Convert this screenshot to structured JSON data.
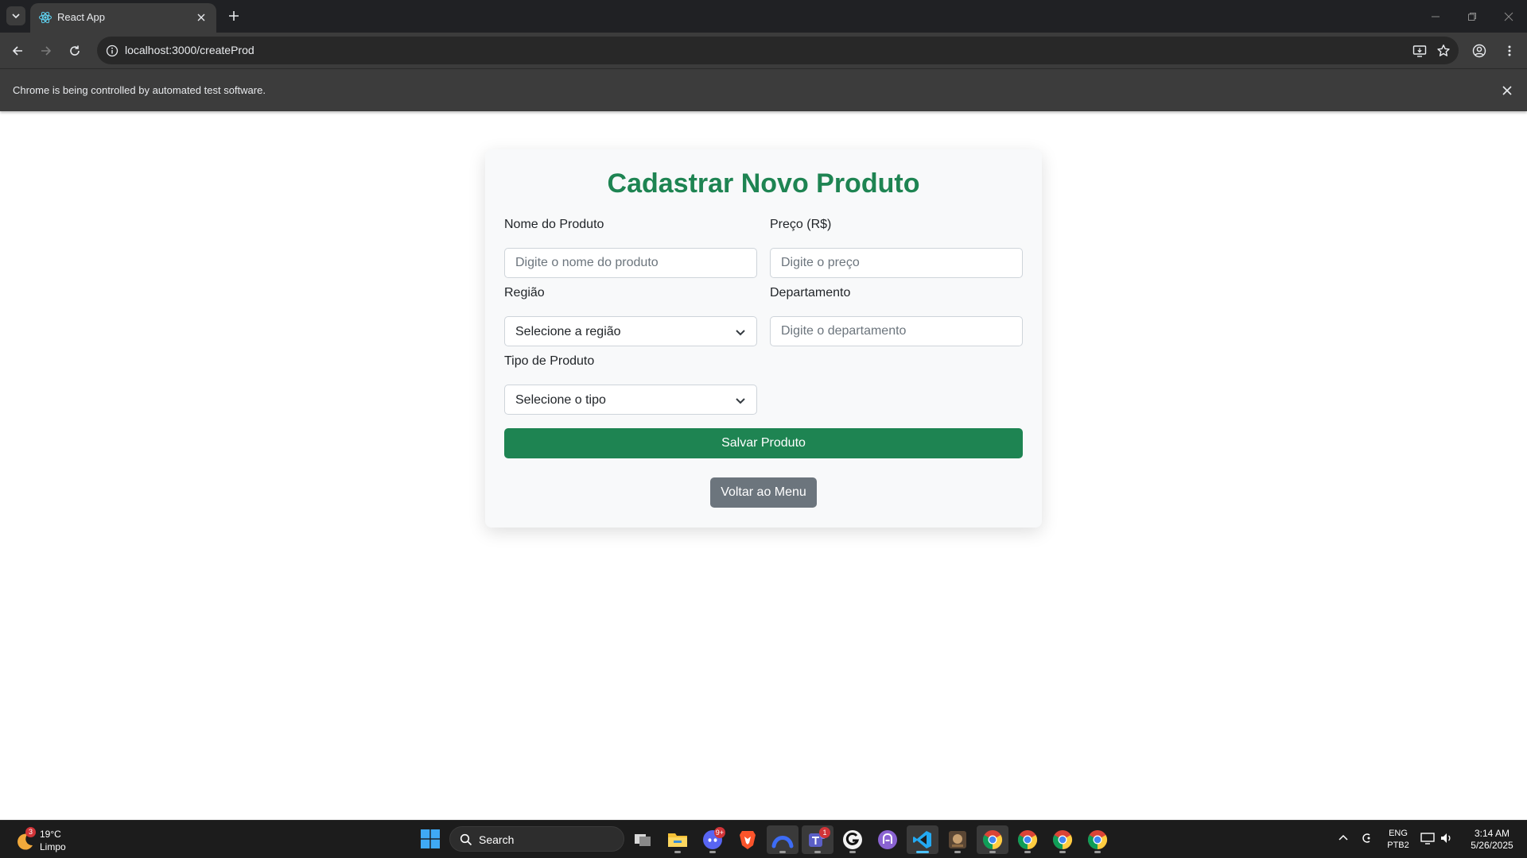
{
  "browser": {
    "tab": {
      "title": "React App"
    },
    "address_bar": {
      "url": "localhost:3000/createProd"
    },
    "infobar": {
      "message": "Chrome is being controlled by automated test software."
    }
  },
  "form": {
    "title": "Cadastrar Novo Produto",
    "fields": {
      "nome": {
        "label": "Nome do Produto",
        "placeholder": "Digite o nome do produto",
        "value": ""
      },
      "preco": {
        "label": "Preço (R$)",
        "placeholder": "Digite o preço",
        "value": ""
      },
      "regiao": {
        "label": "Região",
        "selected": "Selecione a região"
      },
      "departamento": {
        "label": "Departamento",
        "placeholder": "Digite o departamento",
        "value": ""
      },
      "tipo": {
        "label": "Tipo de Produto",
        "selected": "Selecione o tipo"
      }
    },
    "save_label": "Salvar Produto",
    "back_label": "Voltar ao Menu"
  },
  "colors": {
    "primary_green": "#1e8452",
    "secondary_gray": "#6c757d",
    "card_bg": "#f8f9fa"
  },
  "taskbar": {
    "weather": {
      "temp": "19°C",
      "condition": "Limpo",
      "badge": "3"
    },
    "search_label": "Search",
    "apps": [
      {
        "name": "task-view",
        "icon": "task-view-icon"
      },
      {
        "name": "file-explorer",
        "icon": "folder-icon"
      },
      {
        "name": "discord",
        "icon": "discord-icon",
        "badge": "9+"
      },
      {
        "name": "brave",
        "icon": "brave-icon"
      },
      {
        "name": "arc",
        "icon": "arc-icon"
      },
      {
        "name": "teams",
        "icon": "teams-icon",
        "badge": "1"
      },
      {
        "name": "app-g",
        "icon": "g-app-icon"
      },
      {
        "name": "github-desktop",
        "icon": "github-icon"
      },
      {
        "name": "vscode",
        "icon": "vscode-icon"
      },
      {
        "name": "game",
        "icon": "game-icon"
      },
      {
        "name": "chrome-1",
        "icon": "chrome-icon"
      },
      {
        "name": "chrome-2",
        "icon": "chrome-icon"
      },
      {
        "name": "chrome-3",
        "icon": "chrome-icon"
      },
      {
        "name": "chrome-4",
        "icon": "chrome-icon"
      }
    ],
    "tray": {
      "language": "ENG",
      "keyboard": "PTB2",
      "time": "3:14 AM",
      "date": "5/26/2025"
    }
  }
}
